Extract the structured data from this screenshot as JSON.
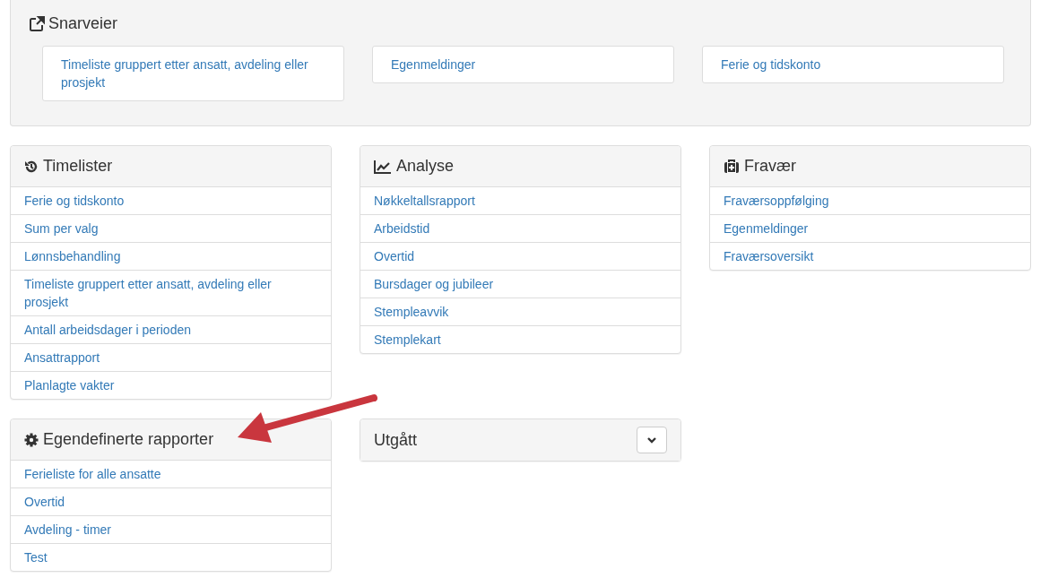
{
  "shortcuts": {
    "title": "Snarveier",
    "links": [
      "Timeliste gruppert etter ansatt, avdeling eller prosjekt",
      "Egenmeldinger",
      "Ferie og tidskonto"
    ]
  },
  "panels": [
    {
      "title": "Timelister",
      "items": [
        "Ferie og tidskonto",
        "Sum per valg",
        "Lønnsbehandling",
        "Timeliste gruppert etter ansatt, avdeling eller prosjekt",
        "Antall arbeidsdager i perioden",
        "Ansattrapport",
        "Planlagte vakter"
      ]
    },
    {
      "title": "Analyse",
      "items": [
        "Nøkkeltallsrapport",
        "Arbeidstid",
        "Overtid",
        "Bursdager og jubileer",
        "Stempleavvik",
        "Stemplekart"
      ]
    },
    {
      "title": "Fravær",
      "items": [
        "Fraværsoppfølging",
        "Egenmeldinger",
        "Fraværsoversikt"
      ]
    },
    {
      "title": "Egendefinerte rapporter",
      "items": [
        "Ferieliste for alle ansatte",
        "Overtid",
        "Avdeling - timer",
        "Test"
      ]
    },
    {
      "title": "Utgått",
      "expanded": false
    }
  ]
}
